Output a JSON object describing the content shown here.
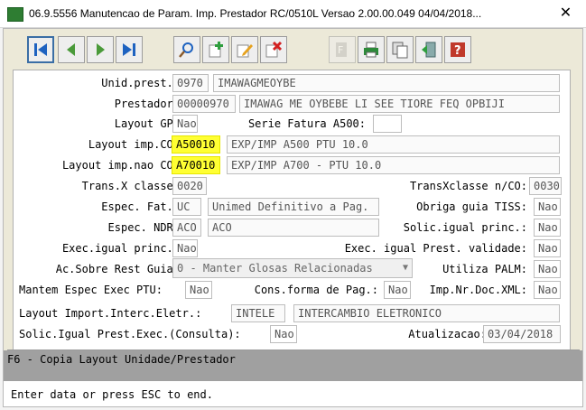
{
  "window": {
    "title": "06.9.5556 Manutencao  de Param. Imp. Prestador RC/0510L Versao 2.00.00.049 04/04/2018...",
    "close_glyph": "✕"
  },
  "toolbar": {
    "buttons": [
      {
        "name": "first-record-button",
        "icon": "first-icon"
      },
      {
        "name": "previous-record-button",
        "icon": "previous-icon"
      },
      {
        "name": "next-record-button",
        "icon": "next-icon"
      },
      {
        "name": "last-record-button",
        "icon": "last-icon"
      },
      {
        "name": "search-button",
        "icon": "search-icon"
      },
      {
        "name": "add-button",
        "icon": "add-icon"
      },
      {
        "name": "edit-button",
        "icon": "edit-icon"
      },
      {
        "name": "delete-button",
        "icon": "delete-icon"
      },
      {
        "name": "filter-button",
        "icon": "filter-icon"
      },
      {
        "name": "print-button",
        "icon": "print-icon"
      },
      {
        "name": "copy-button",
        "icon": "copy-icon"
      },
      {
        "name": "exit-button",
        "icon": "exit-icon"
      },
      {
        "name": "help-button",
        "icon": "help-icon"
      }
    ]
  },
  "form": {
    "unid_prest": {
      "label": "Unid.prest.:",
      "code": "0970",
      "desc": "IMAWAGMEOYBE"
    },
    "prestador": {
      "label": "Prestador:",
      "code": "00000970",
      "desc": "IMAWAG ME OYBEBE LI SEE TIORE FEQ OPBIJI"
    },
    "layout_gp": {
      "label": "Layout GP:",
      "value": "Nao"
    },
    "serie_fatura": {
      "label": "Serie Fatura A500:",
      "value": ""
    },
    "layout_imp_co": {
      "label": "Layout imp.CO:",
      "code": "A50010",
      "desc": "EXP/IMP A500 PTU 10.0"
    },
    "layout_imp_nao_co": {
      "label": "Layout imp.nao CO:",
      "code": "A70010",
      "desc": "EXP/IMP A700 - PTU 10.0"
    },
    "trans_x_classe": {
      "label": "Trans.X classe:",
      "value": "0020"
    },
    "transxclasse_nco": {
      "label": "TransXclasse n/CO:",
      "value": "0030"
    },
    "espec_fat": {
      "label": "Espec. Fat.:",
      "code": "UC",
      "desc": "Unimed Definitivo a Pag."
    },
    "obriga_guia_tiss": {
      "label": "Obriga guia TISS:",
      "value": "Nao"
    },
    "espec_ndr": {
      "label": "Espec. NDR:",
      "code": "ACO",
      "desc": "ACO"
    },
    "solic_igual_princ": {
      "label": "Solic.igual princ.:",
      "value": "Nao"
    },
    "exec_igual_princ": {
      "label": "Exec.igual princ.:",
      "value": "Nao"
    },
    "exec_igual_prest_validade": {
      "label": "Exec. igual Prest. validade:",
      "value": "Nao"
    },
    "ac_sobre_rest_guia": {
      "label": "Ac.Sobre Rest Guia:",
      "value": "0 - Manter Glosas Relacionadas"
    },
    "utiliza_palm": {
      "label": "Utiliza PALM:",
      "value": "Nao"
    },
    "mantem_espec_exec_ptu": {
      "label": "Mantem Espec Exec PTU:",
      "value": "Nao"
    },
    "cons_forma_pag": {
      "label": "Cons.forma de Pag.:",
      "value": "Nao"
    },
    "imp_nr_doc_xml": {
      "label": "Imp.Nr.Doc.XML:",
      "value": "Nao"
    },
    "layout_import_interc": {
      "label": "Layout Import.Interc.Eletr.:",
      "code": "INTELE",
      "desc": "INTERCAMBIO ELETRONICO"
    },
    "solic_igual_prest_exec": {
      "label": "Solic.Igual Prest.Exec.(Consulta):",
      "value": "Nao"
    },
    "atualizacao": {
      "label": "Atualizacao:",
      "value": "03/04/2018"
    }
  },
  "status": {
    "hint": "F6 - Copia Layout Unidade/Prestador",
    "message": "Enter data or press ESC to end."
  },
  "colors": {
    "highlight": "#ffff33",
    "status_bar": "#a0a0a0",
    "accent": "#3a6ea5"
  }
}
